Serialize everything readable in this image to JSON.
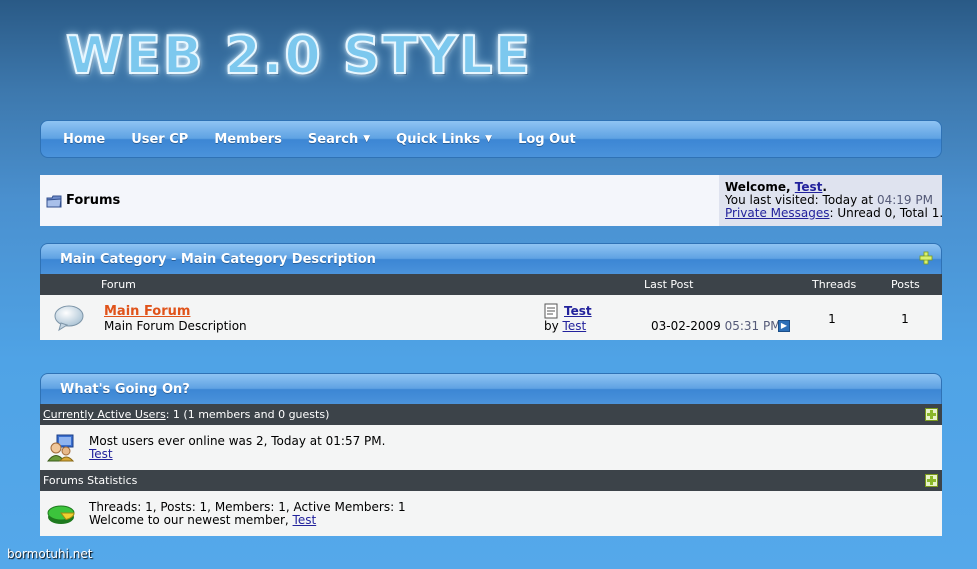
{
  "logo": "WEB 2.0 STYLE",
  "nav": {
    "home": "Home",
    "usercp": "User CP",
    "members": "Members",
    "search": "Search",
    "quicklinks": "Quick Links",
    "logout": "Log Out"
  },
  "breadcrumb": {
    "title": "Forums"
  },
  "welcome": {
    "prefix": "Welcome, ",
    "user": "Test",
    "suffix": ".",
    "last_visited_label": "You last visited: Today at ",
    "last_visited_time": "04:19 PM",
    "pm_link": "Private Messages",
    "pm_status": ": Unread 0, Total 1."
  },
  "category": {
    "title": "Main Category - Main Category Description",
    "col_forum": "Forum",
    "col_lastpost": "Last Post",
    "col_threads": "Threads",
    "col_posts": "Posts",
    "forum": {
      "name": "Main Forum",
      "description": "Main Forum Description",
      "lastpost_title": "Test",
      "lastpost_by_label": "by ",
      "lastpost_by": "Test",
      "lastpost_date": "03-02-2009",
      "lastpost_time": "05:31 PM",
      "threads": "1",
      "posts": "1"
    }
  },
  "whats_going_on": {
    "title": "What's Going On?",
    "active_users_link": "Currently Active Users",
    "active_users_count": ": 1 (1 members and 0 guests)",
    "most_online": "Most users ever online was 2, Today at 01:57 PM.",
    "active_user": "Test",
    "stats_label": "Forums Statistics",
    "stats_line": "Threads: 1, Posts: 1, Members: 1, Active Members: 1",
    "newest_label": "Welcome to our newest member, ",
    "newest_member": "Test"
  },
  "watermark": "bormotuhi.net",
  "colors": {
    "nav_blue": "#4b93db",
    "header_dark": "#3c4349",
    "forum_link": "#e0531a",
    "link": "#22229c"
  }
}
